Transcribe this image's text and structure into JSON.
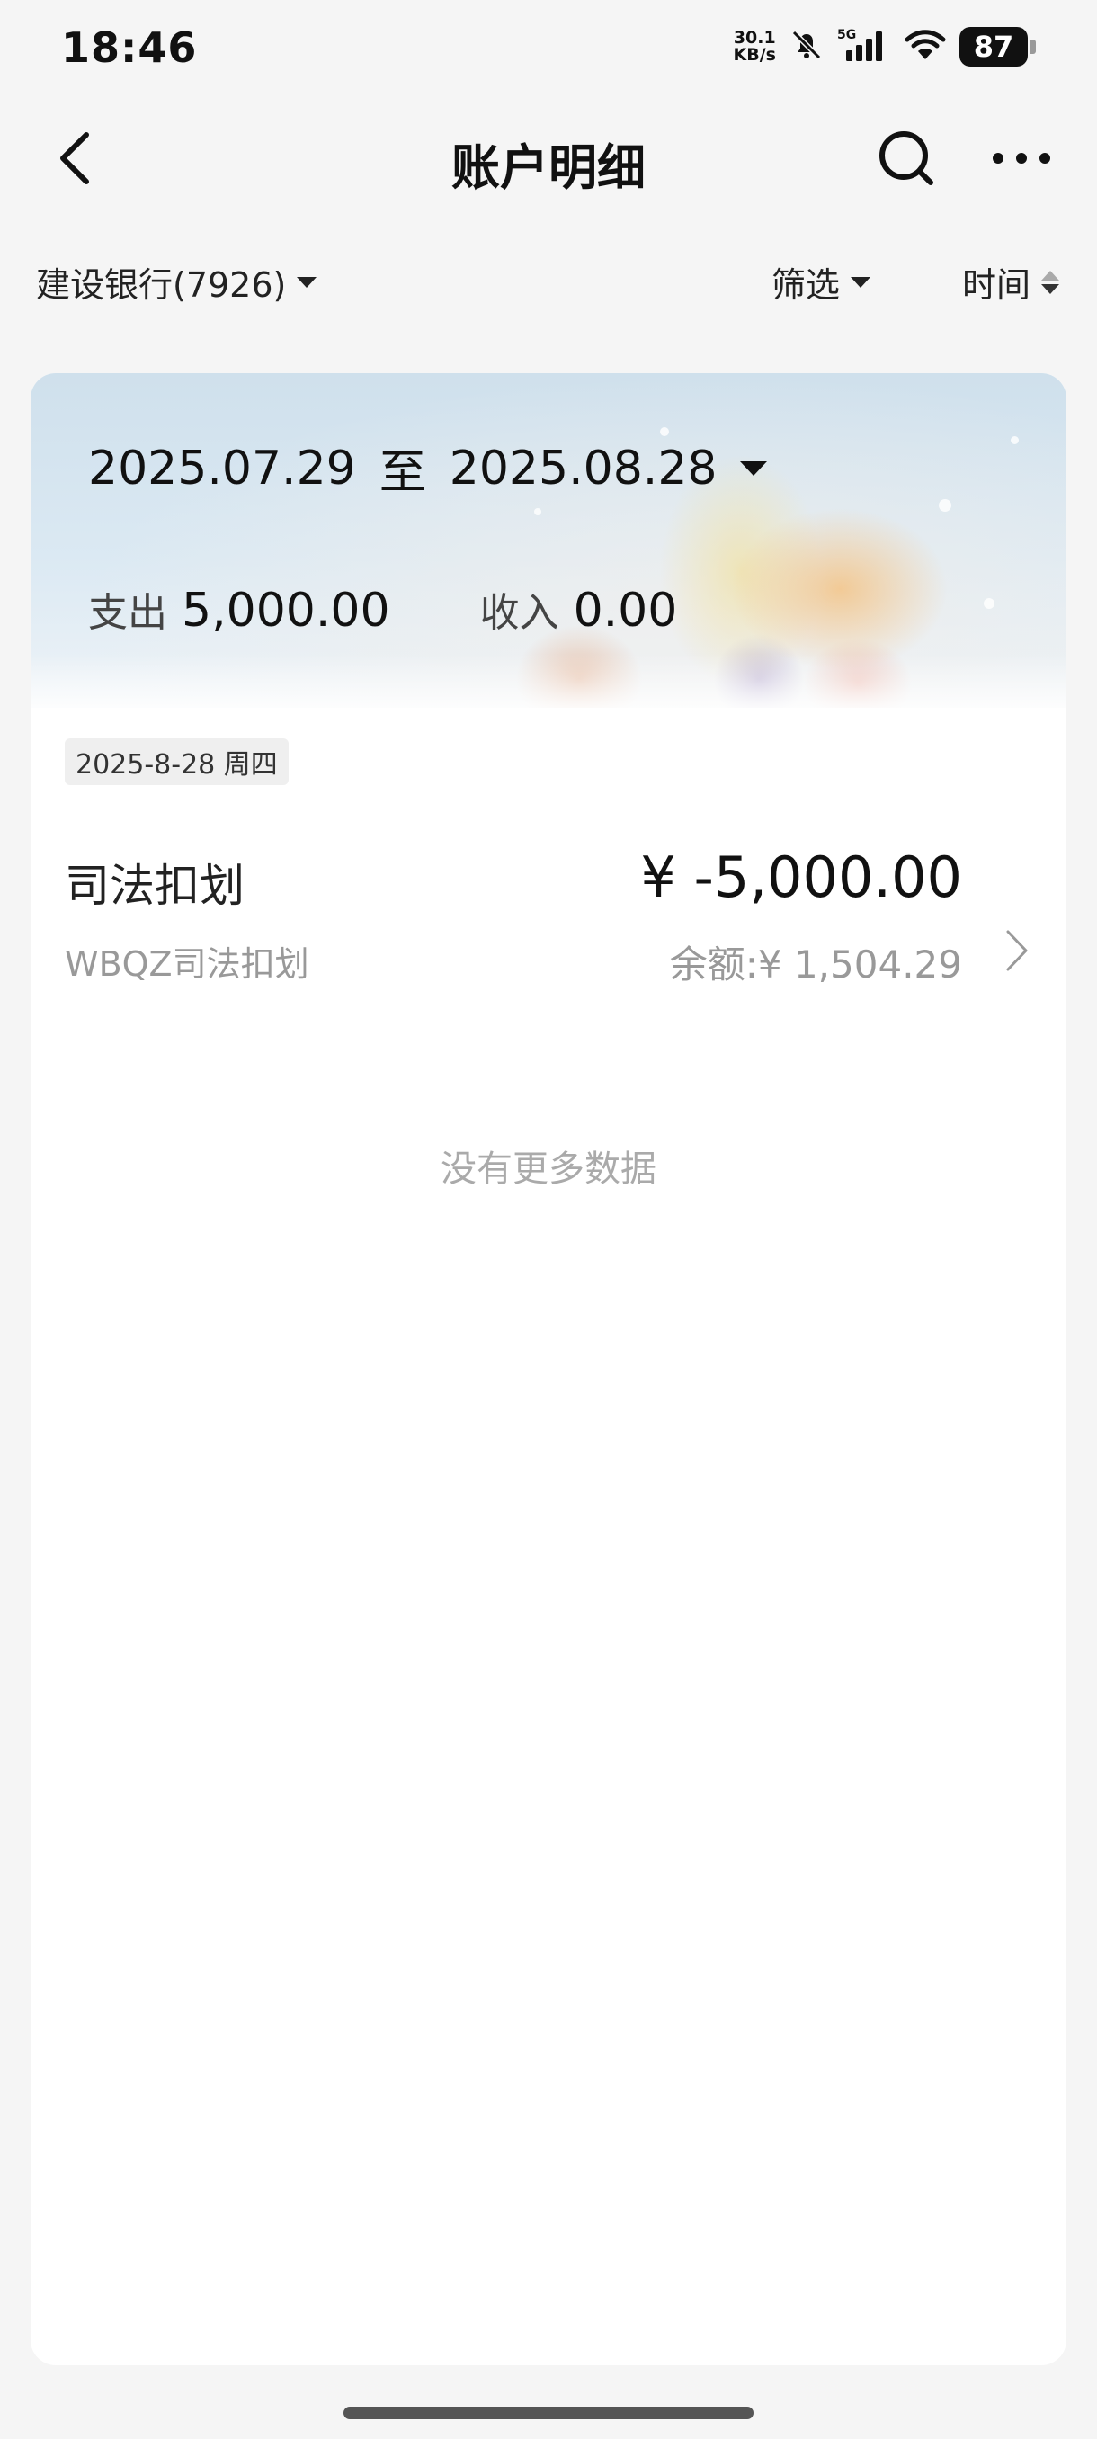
{
  "status_bar": {
    "time": "18:46",
    "net_speed_value": "30.1",
    "net_speed_unit": "KB/s",
    "network_type": "5G",
    "battery_level": "87",
    "icons": [
      "mute-bell-icon",
      "signal-icon",
      "wifi-icon",
      "battery-icon"
    ]
  },
  "header": {
    "title": "账户明细",
    "icons": [
      "back-icon",
      "search-icon",
      "more-icon"
    ]
  },
  "filters": {
    "account_label": "建设银行(7926)",
    "filter_label": "筛选",
    "time_sort_label": "时间"
  },
  "summary": {
    "date_from": "2025.07.29",
    "date_sep": "至",
    "date_to": "2025.08.28",
    "expense_label": "支出",
    "expense_amount": "5,000.00",
    "income_label": "收入",
    "income_amount": "0.00"
  },
  "transactions": {
    "groups": [
      {
        "date_label": "2025-8-28 周四",
        "items": [
          {
            "title": "司法扣划",
            "description": "WBQZ司法扣划",
            "amount": "¥ -5,000.00",
            "balance_label": "余额:",
            "balance_value": "¥ 1,504.29"
          }
        ]
      }
    ],
    "no_more_text": "没有更多数据"
  },
  "colors": {
    "background": "#f5f5f5",
    "card": "#ffffff",
    "text_primary": "#111111",
    "text_secondary": "#999999"
  }
}
